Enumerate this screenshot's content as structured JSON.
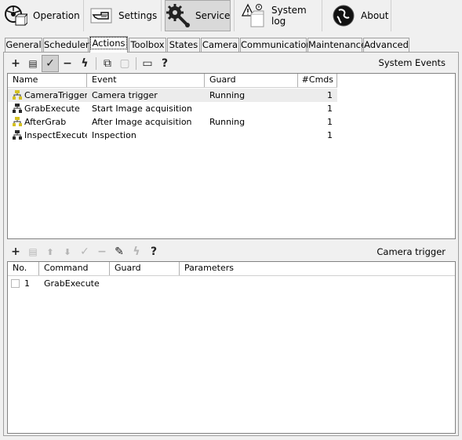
{
  "nav": [
    {
      "label": "Operation",
      "icon": "operation-icon",
      "active": false
    },
    {
      "label": "Settings",
      "icon": "settings-hand-icon",
      "active": false
    },
    {
      "label": "Service",
      "icon": "service-gear-wrench-icon",
      "active": true
    },
    {
      "label": "System log",
      "icon": "system-log-icon",
      "active": false
    },
    {
      "label": "About",
      "icon": "about-globe-icon",
      "active": false
    }
  ],
  "tabs": [
    "General",
    "Scheduler",
    "Actions",
    "Toolbox",
    "States",
    "Camera",
    "Communication",
    "Maintenance",
    "Advanced"
  ],
  "active_tab": "Actions",
  "events_toolbar": {
    "caption": "System Events",
    "buttons": [
      {
        "name": "add",
        "glyph": "+"
      },
      {
        "name": "duplicate",
        "glyph": "▤"
      },
      {
        "name": "enable",
        "glyph": "✓"
      },
      {
        "name": "remove",
        "glyph": "−"
      },
      {
        "name": "execute",
        "glyph": "ϟ"
      },
      {
        "name": "copy",
        "glyph": "⧉"
      },
      {
        "name": "paste",
        "glyph": "▢"
      },
      {
        "name": "properties",
        "glyph": "▭"
      },
      {
        "name": "help",
        "glyph": "?"
      }
    ]
  },
  "events_table": {
    "columns": [
      "Name",
      "Event",
      "Guard",
      "#Cmds"
    ],
    "rows": [
      {
        "name": "CameraTrigger",
        "event": "Camera trigger",
        "guard": "Running",
        "cmds": "1"
      },
      {
        "name": "GrabExecute",
        "event": "Start Image acquisition",
        "guard": "",
        "cmds": "1"
      },
      {
        "name": "AfterGrab",
        "event": "After Image acquisition",
        "guard": "Running",
        "cmds": "1"
      },
      {
        "name": "InspectExecute",
        "event": "Inspection",
        "guard": "",
        "cmds": "1"
      }
    ]
  },
  "commands_toolbar": {
    "caption": "Camera trigger",
    "buttons": [
      {
        "name": "add",
        "glyph": "+"
      },
      {
        "name": "duplicate",
        "glyph": "▤"
      },
      {
        "name": "move-up",
        "glyph": "⬆"
      },
      {
        "name": "move-down",
        "glyph": "⬇"
      },
      {
        "name": "enable",
        "glyph": "✓"
      },
      {
        "name": "remove",
        "glyph": "−"
      },
      {
        "name": "edit",
        "glyph": "✎"
      },
      {
        "name": "execute",
        "glyph": "ϟ"
      },
      {
        "name": "help",
        "glyph": "?"
      }
    ]
  },
  "commands_table": {
    "columns": [
      "No.",
      "Command",
      "Guard",
      "Parameters"
    ],
    "rows": [
      {
        "no": "1",
        "command": "GrabExecute",
        "guard": "",
        "parameters": ""
      }
    ]
  },
  "colors": {
    "icon_yellow": "#d4c020",
    "icon_dark": "#2a2a2a",
    "selected_row": "#ececec"
  }
}
